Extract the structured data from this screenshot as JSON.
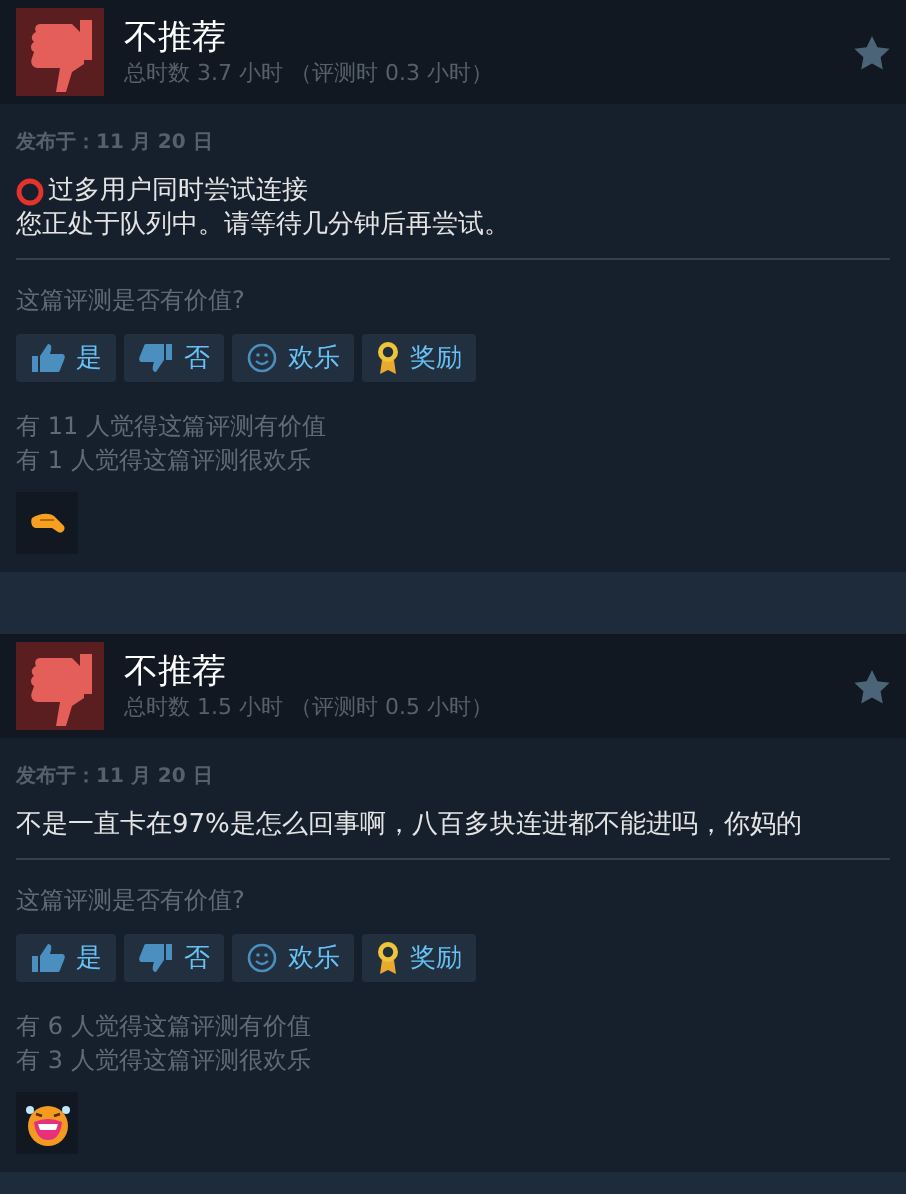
{
  "reviews": [
    {
      "recommended": false,
      "verdict": "不推荐",
      "hours": "总时数 3.7 小时 （评测时 0.3 小时）",
      "posted": "发布于：11 月 20 日",
      "body": [
        {
          "kind": "alert",
          "text": "过多用户同时尝试连接"
        },
        {
          "text": "您正处于队列中。请等待几分钟后再尝试。"
        }
      ],
      "question": "这篇评测是否有价值?",
      "buttons": [
        {
          "kind": "yes",
          "label": "是"
        },
        {
          "kind": "no",
          "label": "否"
        },
        {
          "kind": "funny",
          "label": "欢乐"
        },
        {
          "kind": "award",
          "label": "奖励"
        }
      ],
      "counts": [
        "有 11 人觉得这篇评测有价值",
        "有 1 人觉得这篇评测很欢乐"
      ],
      "awards": [
        {
          "kind": "hand"
        }
      ]
    },
    {
      "recommended": false,
      "verdict": "不推荐",
      "hours": "总时数 1.5 小时 （评测时 0.5 小时）",
      "posted": "发布于：11 月 20 日",
      "body": [
        {
          "text": "不是一直卡在97%是怎么回事啊，八百多块连进都不能进吗，你妈的"
        }
      ],
      "question": "这篇评测是否有价值?",
      "buttons": [
        {
          "kind": "yes",
          "label": "是"
        },
        {
          "kind": "no",
          "label": "否"
        },
        {
          "kind": "funny",
          "label": "欢乐"
        },
        {
          "kind": "award",
          "label": "奖励"
        }
      ],
      "counts": [
        "有 6 人觉得这篇评测有价值",
        "有 3 人觉得这篇评测很欢乐"
      ],
      "awards": [
        {
          "kind": "laugh"
        }
      ]
    }
  ]
}
